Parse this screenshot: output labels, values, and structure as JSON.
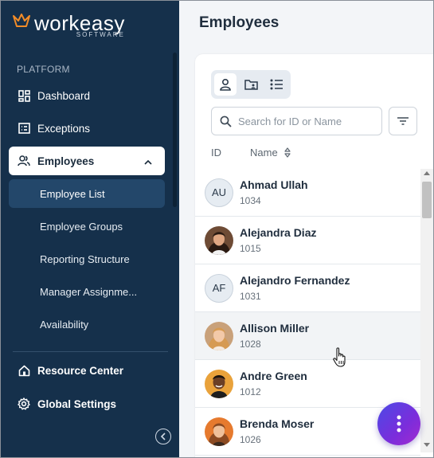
{
  "app": {
    "logo_word": "workeasy",
    "logo_sub": "SOFTWARE",
    "brand_orange": "#f28c28",
    "sidebar_bg": "#15304b"
  },
  "sidebar": {
    "section_label": "PLATFORM",
    "items": [
      {
        "label": "Dashboard",
        "icon": "dashboard-icon"
      },
      {
        "label": "Exceptions",
        "icon": "exceptions-icon"
      },
      {
        "label": "Employees",
        "icon": "employees-icon",
        "expanded": true
      }
    ],
    "sub_items": [
      {
        "label": "Employee List",
        "selected": true
      },
      {
        "label": "Employee Groups"
      },
      {
        "label": "Reporting Structure"
      },
      {
        "label": "Manager Assignme..."
      },
      {
        "label": "Availability"
      }
    ],
    "bottom_items": [
      {
        "label": "Resource Center",
        "icon": "home-icon"
      },
      {
        "label": "Global Settings",
        "icon": "gear-icon"
      }
    ]
  },
  "main": {
    "title": "Employees",
    "search_placeholder": "Search for ID or Name",
    "columns": {
      "id": "ID",
      "name": "Name"
    },
    "employees": [
      {
        "name": "Ahmad Ullah",
        "id": "1034",
        "initials": "AU"
      },
      {
        "name": "Alejandra Diaz",
        "id": "1015",
        "photo": true
      },
      {
        "name": "Alejandro Fernandez",
        "id": "1031",
        "initials": "AF"
      },
      {
        "name": "Allison Miller",
        "id": "1028",
        "photo": true
      },
      {
        "name": "Andre Green",
        "id": "1012",
        "photo": true
      },
      {
        "name": "Brenda Moser",
        "id": "1026",
        "photo": true
      }
    ]
  }
}
